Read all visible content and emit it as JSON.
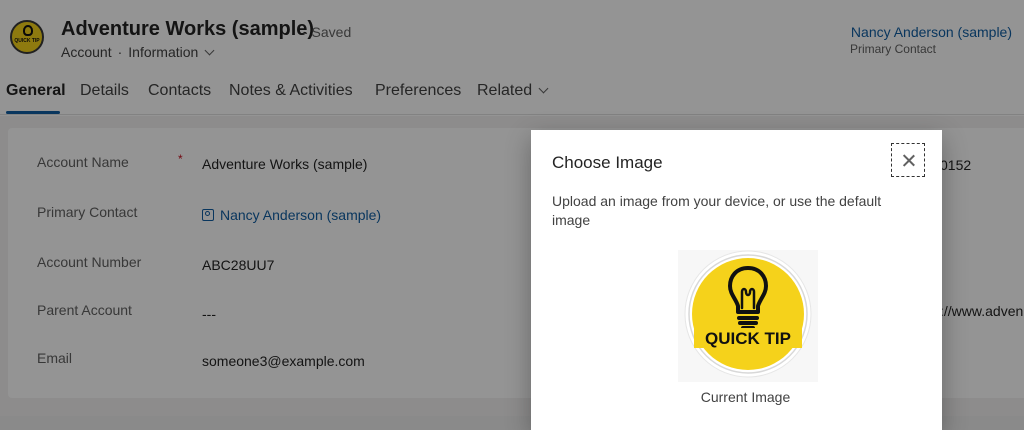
{
  "header": {
    "title": "Adventure Works (sample)",
    "saved": "- Saved",
    "entity": "Account",
    "form": "Information",
    "owner_name": "Nancy Anderson (sample)",
    "owner_role": "Primary Contact",
    "logo_text": "QUICK TIP"
  },
  "tabs": [
    {
      "label": "General"
    },
    {
      "label": "Details"
    },
    {
      "label": "Contacts"
    },
    {
      "label": "Notes & Activities"
    },
    {
      "label": "Preferences"
    },
    {
      "label": "Related"
    }
  ],
  "form": {
    "fields": [
      {
        "label": "Account Name",
        "value": "Adventure Works (sample)",
        "required": "*"
      },
      {
        "label": "Primary Contact",
        "value": "Nancy Anderson (sample)"
      },
      {
        "label": "Account Number",
        "value": "ABC28UU7"
      },
      {
        "label": "Parent Account",
        "value": "---"
      },
      {
        "label": "Email",
        "value": "someone3@example.com"
      }
    ],
    "right_values": [
      "0152",
      "://www.adven"
    ]
  },
  "dialog": {
    "title": "Choose Image",
    "description": "Upload an image from your device, or use the default image",
    "image_text": "QUICK TIP",
    "caption": "Current Image"
  },
  "colors": {
    "accent": "#115ea3",
    "required": "#c50f1f",
    "logo_yellow": "#f5d21b"
  }
}
